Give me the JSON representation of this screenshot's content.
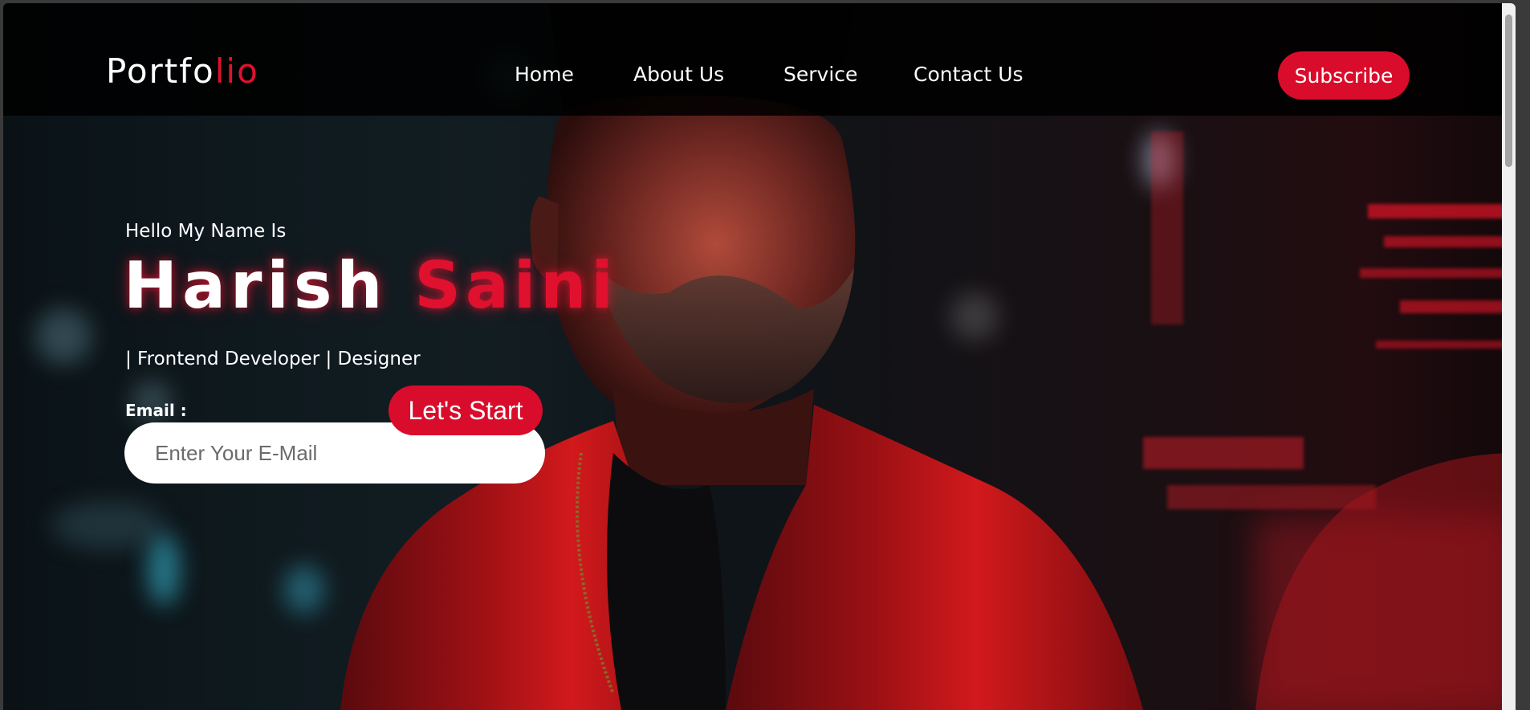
{
  "header": {
    "logo_prefix": "Portfo",
    "logo_suffix": "lio",
    "nav": [
      {
        "label": "Home"
      },
      {
        "label": "About Us"
      },
      {
        "label": "Service"
      },
      {
        "label": "Contact Us"
      }
    ],
    "subscribe_label": "Subscribe"
  },
  "hero": {
    "greeting": "Hello My Name Is",
    "first_name": "Harish",
    "last_name": "Saini",
    "tagline": "| Frontend Developer | Designer",
    "email_label": "Email :",
    "email_placeholder": "Enter Your E-Mail",
    "start_label": "Let's Start"
  },
  "colors": {
    "accent": "#d90d2b",
    "header_bg": "#000000",
    "text": "#ffffff"
  },
  "icons": {
    "background": "hero-portrait-photo"
  }
}
